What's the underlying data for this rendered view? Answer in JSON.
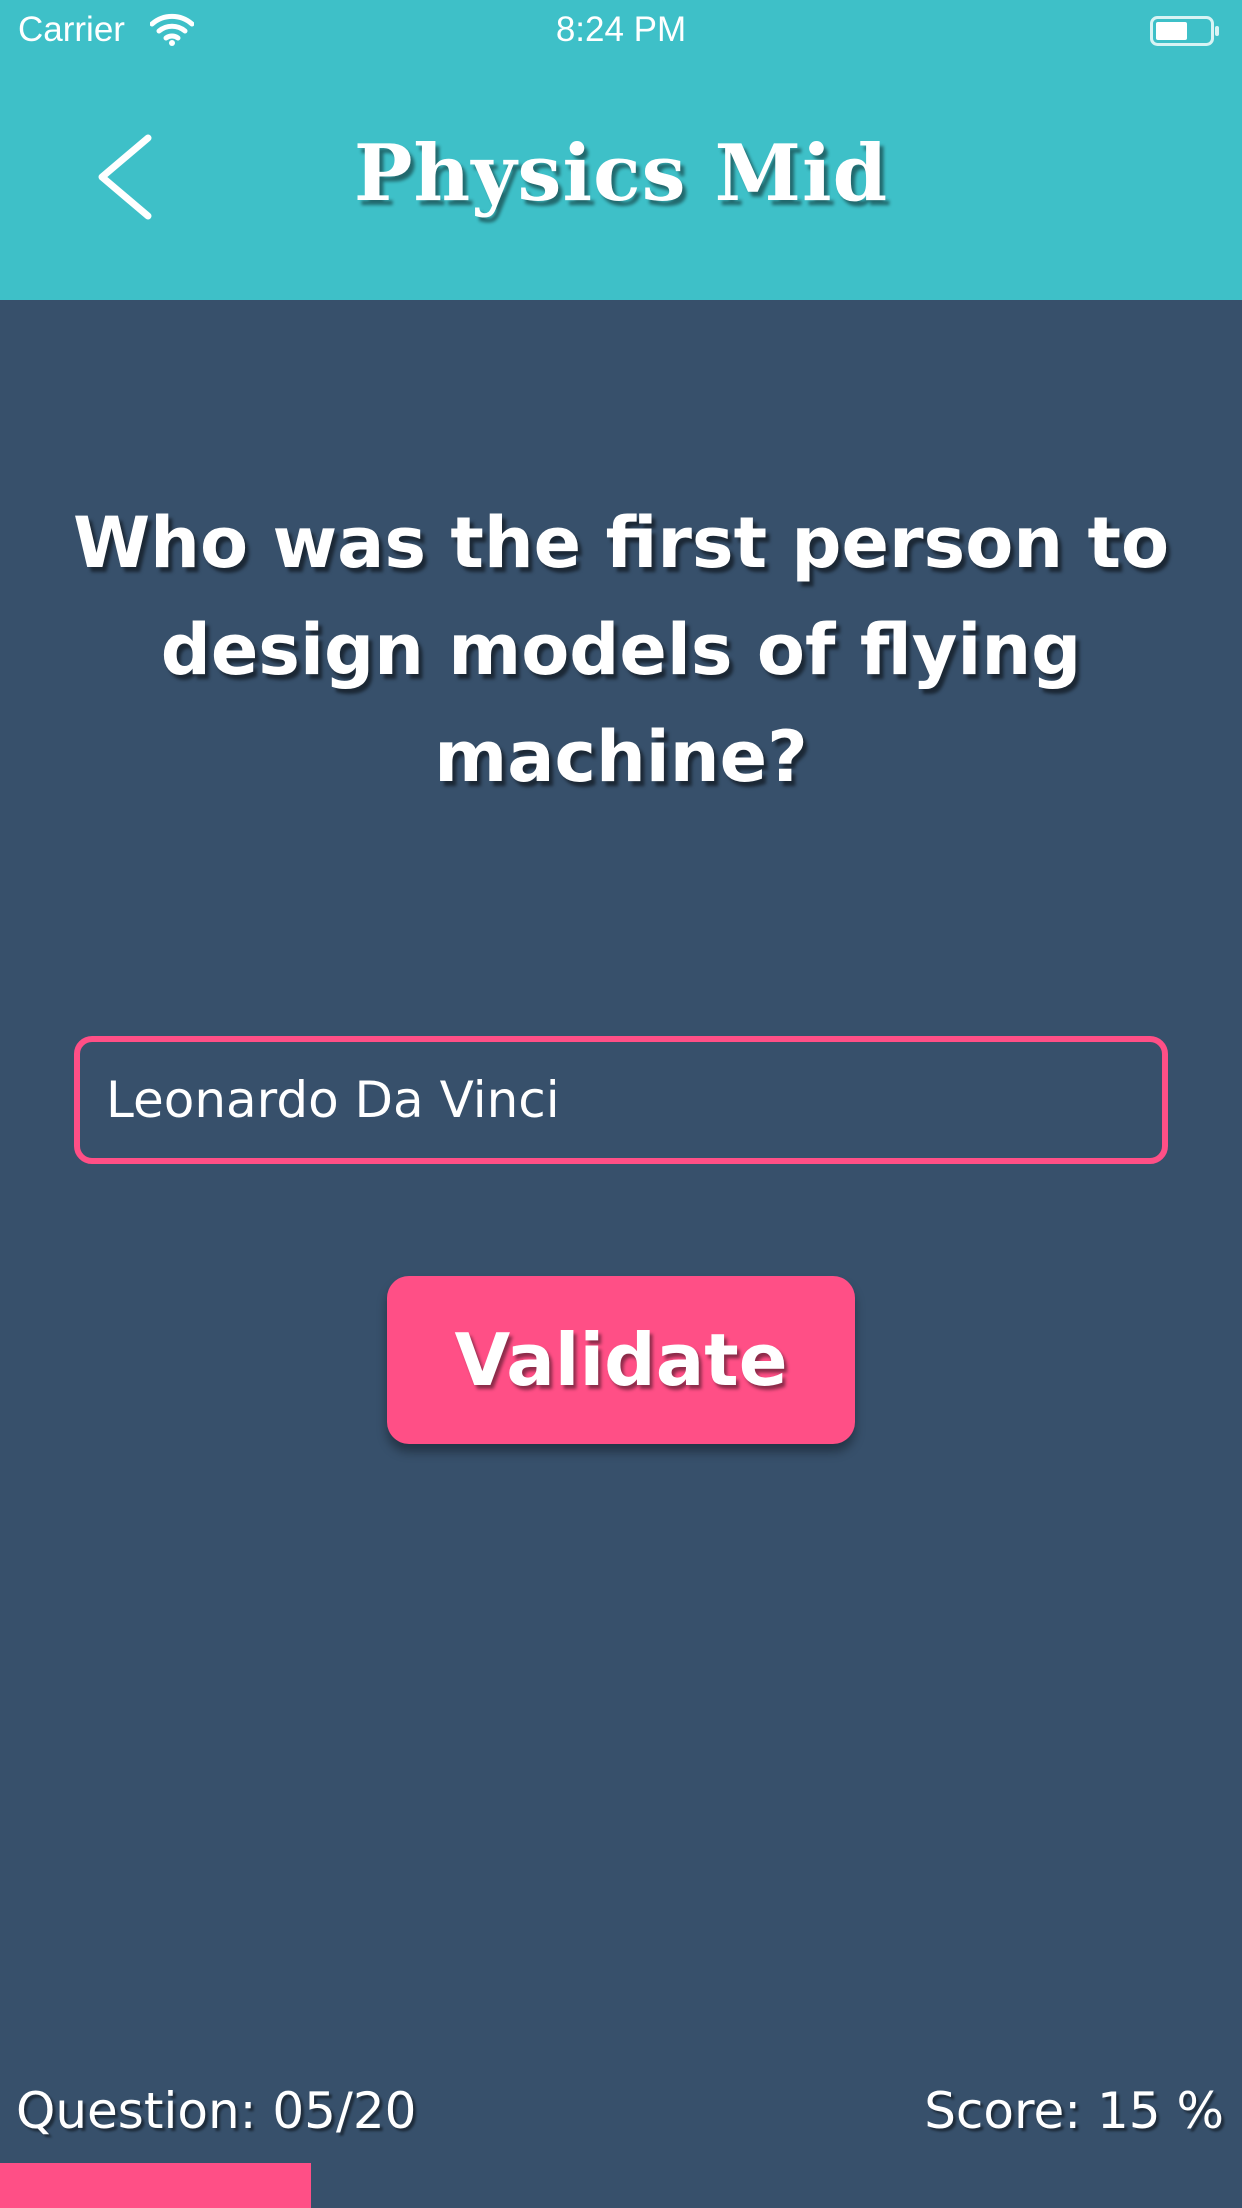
{
  "status_bar": {
    "carrier": "Carrier",
    "time": "8:24 PM",
    "battery_level": 0.6
  },
  "header": {
    "title": "Physics Mid"
  },
  "quiz": {
    "question": "Who was the first person to design models of flying machine?",
    "answer_value": "Leonardo Da Vinci",
    "validate_label": "Validate"
  },
  "footer": {
    "question_label": "Question: 05/20",
    "score_label": "Score: 15 %",
    "progress": 0.25
  },
  "colors": {
    "header_bg": "#3ec0c8",
    "page_bg": "#37506b",
    "accent": "#ff4f86",
    "text": "#ffffff"
  },
  "icons": {
    "back": "chevron-left-icon",
    "wifi": "wifi-icon",
    "battery": "battery-icon"
  }
}
